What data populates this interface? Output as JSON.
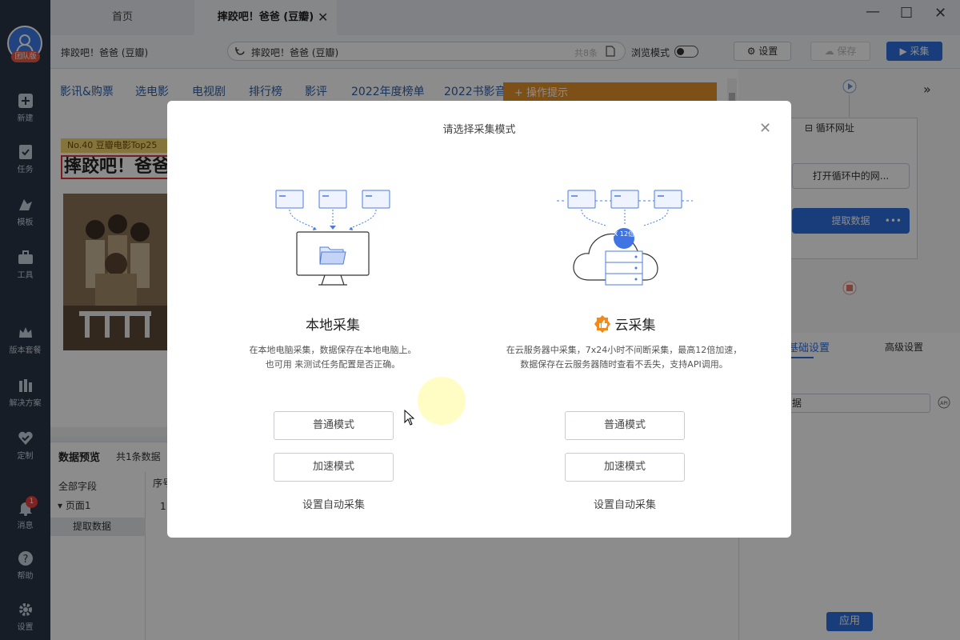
{
  "sidebar": {
    "logo_badge": "团队版",
    "items": [
      {
        "label": "新建",
        "icon": "plus-icon"
      },
      {
        "label": "任务",
        "icon": "task-flag-icon"
      },
      {
        "label": "模板",
        "icon": "template-icon"
      },
      {
        "label": "工具",
        "icon": "toolbox-icon"
      },
      {
        "label": "版本套餐",
        "icon": "crown-icon"
      },
      {
        "label": "解决方案",
        "icon": "solution-icon"
      },
      {
        "label": "定制",
        "icon": "heart-check-icon"
      },
      {
        "label": "消息",
        "icon": "bell-icon"
      },
      {
        "label": "帮助",
        "icon": "help-icon"
      },
      {
        "label": "设置",
        "icon": "gear-icon"
      }
    ],
    "message_badge": "1"
  },
  "tabs": {
    "home": "首页",
    "current": "摔跤吧！爸爸 (豆瓣)",
    "close": "✕"
  },
  "window": {
    "minimize": "—",
    "maximize": "☐",
    "close": "✕"
  },
  "addressbar": {
    "page_name": "摔跤吧！爸爸 (豆瓣)",
    "url": "摔跤吧！爸爸 (豆瓣)",
    "rows": "共8条",
    "browse_mode": "浏览模式",
    "settings": "设置",
    "save": "保存",
    "collect": "采集"
  },
  "page": {
    "nav": [
      "影讯&购票",
      "选电影",
      "电视剧",
      "排行榜",
      "影评",
      "2022年度榜单",
      "2022书影音"
    ],
    "ops_tip": "操作提示",
    "rank_badge": "No.40 豆瓣电影Top25",
    "title": "摔跤吧！爸爸"
  },
  "preview": {
    "title": "数据预览",
    "count": "共1条数据",
    "all_fields": "全部字段",
    "page1": "页面1",
    "extract": "提取数据",
    "col_seq": "序号",
    "row_1": "1"
  },
  "flow": {
    "loop": "循环网址",
    "open_loop": "打开循环中的网...",
    "extract": "提取数据",
    "tab_basic": "基础设置",
    "tab_advanced": "高级设置",
    "name_value": "据",
    "apply": "应用"
  },
  "modal": {
    "title": "请选择采集模式",
    "close": "✕",
    "local": {
      "title": "本地采集",
      "desc1": "在本地电脑采集，数据保存在本地电脑上。",
      "desc2": "也可用 来测试任务配置是否正确。",
      "normal": "普通模式",
      "speed": "加速模式",
      "auto": "设置自动采集"
    },
    "cloud": {
      "title": "云采集",
      "badge": "X 12倍",
      "desc1": "在云服务器中采集，7x24小时不间断采集，最高12倍加速，",
      "desc2": "数据保存在云服务器随时查看不丢失，支持API调用。",
      "normal": "普通模式",
      "speed": "加速模式",
      "auto": "设置自动采集"
    }
  },
  "colors": {
    "primary": "#2f6fde",
    "orange": "#e4922d",
    "sidebar": "#2b3547"
  }
}
